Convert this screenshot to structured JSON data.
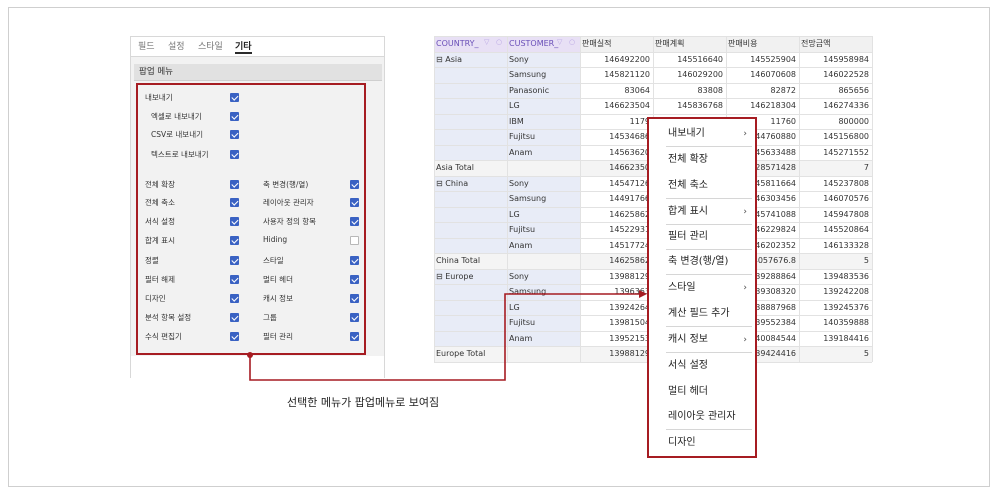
{
  "tabs": [
    "필드",
    "설정",
    "스타일",
    "기타"
  ],
  "active_tab": "기타",
  "section_title": "팝업 메뉴",
  "options_left": [
    {
      "label": "내보내기",
      "checked": true
    },
    {
      "label": "엑셀로 내보내기",
      "checked": true
    },
    {
      "label": "CSV로 내보내기",
      "checked": true
    },
    {
      "label": "텍스트로 내보내기",
      "checked": true
    },
    {
      "label": "전체 확장",
      "checked": true
    },
    {
      "label": "전체 축소",
      "checked": true
    },
    {
      "label": "서식 설정",
      "checked": true
    },
    {
      "label": "합계 표시",
      "checked": true
    },
    {
      "label": "정렬",
      "checked": true
    },
    {
      "label": "필터 해제",
      "checked": true
    },
    {
      "label": "디자인",
      "checked": true
    },
    {
      "label": "분석 항목 설정",
      "checked": true
    },
    {
      "label": "수식 편집기",
      "checked": true
    }
  ],
  "options_right": [
    {
      "label": "축 변경(행/열)",
      "checked": true
    },
    {
      "label": "레이아웃 관리자",
      "checked": true
    },
    {
      "label": "사용자 정의 항목",
      "checked": true
    },
    {
      "label": "Hiding",
      "checked": false
    },
    {
      "label": "스타일",
      "checked": true
    },
    {
      "label": "멀티 헤더",
      "checked": true
    },
    {
      "label": "캐시 정보",
      "checked": true
    },
    {
      "label": "그룹",
      "checked": true
    },
    {
      "label": "필터 관리",
      "checked": true
    }
  ],
  "grid": {
    "headers": [
      "COUNTRY_",
      "CUSTOMER_",
      "판매실적",
      "판매계획",
      "판매비용",
      "전망금액"
    ],
    "rows": [
      {
        "country": "⊟ Asia",
        "customer": "Sony",
        "v": [
          "146492200",
          "145516640",
          "145525904",
          "145958984"
        ]
      },
      {
        "country": "",
        "customer": "Samsung",
        "v": [
          "145821120",
          "146029200",
          "146070608",
          "146022528"
        ]
      },
      {
        "country": "",
        "customer": "Panasonic",
        "v": [
          "83064",
          "83808",
          "82872",
          "865656"
        ]
      },
      {
        "country": "",
        "customer": "LG",
        "v": [
          "146623504",
          "145836768",
          "146218304",
          "146274336"
        ]
      },
      {
        "country": "",
        "customer": "IBM",
        "v": [
          "1179",
          "",
          "11760",
          "800000"
        ]
      },
      {
        "country": "",
        "customer": "Fujitsu",
        "v": [
          "14534686",
          "",
          "44760880",
          "145156800"
        ]
      },
      {
        "country": "",
        "customer": "Anam",
        "v": [
          "14563620",
          "",
          "45633488",
          "145271552"
        ]
      },
      {
        "country": "Asia Total",
        "customer": "",
        "v": [
          "14662350",
          "",
          "28571428",
          "7"
        ],
        "total": true
      },
      {
        "country": "⊟ China",
        "customer": "Sony",
        "v": [
          "14547126",
          "",
          "45811664",
          "145237808"
        ]
      },
      {
        "country": "",
        "customer": "Samsung",
        "v": [
          "14491766",
          "",
          "46303456",
          "146070576"
        ]
      },
      {
        "country": "",
        "customer": "LG",
        "v": [
          "14625862",
          "",
          "45741088",
          "145947808"
        ]
      },
      {
        "country": "",
        "customer": "Fujitsu",
        "v": [
          "14522931",
          "",
          "46229824",
          "145520864"
        ]
      },
      {
        "country": "",
        "customer": "Anam",
        "v": [
          "14517724",
          "",
          "46202352",
          "146133328"
        ]
      },
      {
        "country": "China Total",
        "customer": "",
        "v": [
          "14625862",
          "",
          "4057676.8",
          "5"
        ],
        "total": true
      },
      {
        "country": "⊟ Europe",
        "customer": "Sony",
        "v": [
          "13988129",
          "",
          "39288864",
          "139483536"
        ]
      },
      {
        "country": "",
        "customer": "Samsung",
        "v": [
          "1396363",
          "",
          "39308320",
          "139242208"
        ]
      },
      {
        "country": "",
        "customer": "LG",
        "v": [
          "13924264",
          "",
          "38887968",
          "139245376"
        ]
      },
      {
        "country": "",
        "customer": "Fujitsu",
        "v": [
          "13981504",
          "",
          "39552384",
          "140359888"
        ]
      },
      {
        "country": "",
        "customer": "Anam",
        "v": [
          "13952153",
          "",
          "40084544",
          "139184416"
        ]
      },
      {
        "country": "Europe Total",
        "customer": "",
        "v": [
          "13988129",
          "",
          "39424416",
          "5"
        ],
        "total": true
      }
    ]
  },
  "context_menu": [
    {
      "label": "내보내기",
      "submenu": true
    },
    {
      "label": "전체 확장",
      "submenu": false
    },
    {
      "label": "전체 축소",
      "submenu": false
    },
    {
      "label": "합계 표시",
      "submenu": true
    },
    {
      "label": "필터 관리",
      "submenu": false
    },
    {
      "label": "축 변경(행/열)",
      "submenu": false
    },
    {
      "label": "스타일",
      "submenu": true
    },
    {
      "label": "계산 필드 추가",
      "submenu": false
    },
    {
      "label": "캐시 정보",
      "submenu": true
    },
    {
      "label": "서식 설정",
      "submenu": false
    },
    {
      "label": "멀티 헤더",
      "submenu": false
    },
    {
      "label": "레이아웃 관리자",
      "submenu": false
    },
    {
      "label": "디자인",
      "submenu": false
    }
  ],
  "caption": "선택한 메뉴가 팝업메뉴로 보여짐",
  "colors": {
    "accent": "#a61c22",
    "checkbox": "#3a62c3",
    "header": "#e8e0f5"
  }
}
